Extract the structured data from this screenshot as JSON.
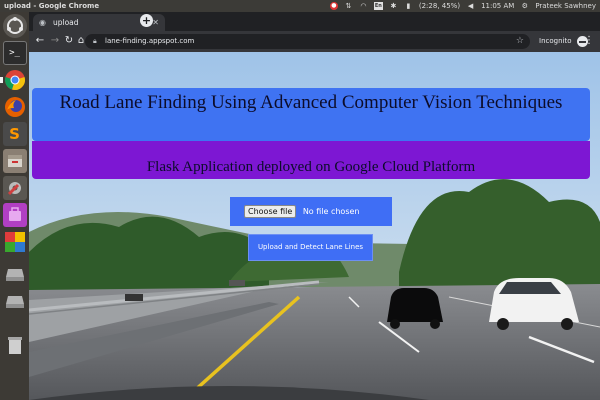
{
  "system_bar": {
    "window_title": "upload - Google Chrome",
    "keyboard": "En",
    "battery": "(2:28, 45%)",
    "time": "11:05 AM",
    "user": "Prateek Sawhney"
  },
  "launcher": {
    "items": [
      {
        "icon": "ubuntu-dash-icon",
        "color": "#c8c8c8"
      },
      {
        "icon": "terminal-icon",
        "color": "#2b2b2b"
      },
      {
        "icon": "chrome-icon",
        "color": "#e8a02a"
      },
      {
        "icon": "firefox-icon",
        "color": "#e66000"
      },
      {
        "icon": "sublime-text-icon",
        "color": "#4a4a4a"
      },
      {
        "icon": "files-icon",
        "color": "#8a7f73"
      },
      {
        "icon": "system-settings-icon",
        "color": "#d04040"
      },
      {
        "icon": "ubuntu-software-icon",
        "color": "#b13fc3"
      },
      {
        "icon": "libreoffice-icon",
        "color": "#39a82e"
      },
      {
        "icon": "drive-icon",
        "color": "#9b9b9b"
      },
      {
        "icon": "drive-icon-2",
        "color": "#9b9b9b"
      },
      {
        "icon": "trash-icon",
        "color": "#a6a6a6"
      }
    ]
  },
  "browser": {
    "tab_title": "upload",
    "url": "lane-finding.appspot.com",
    "incognito_label": "Incognito"
  },
  "page": {
    "heading": "Road Lane Finding Using Advanced Computer Vision Techniques",
    "subheading": "Flask Application deployed on Google Cloud Platform",
    "choose_file_label": "Choose file",
    "no_file_text": "No file chosen",
    "upload_button_label": "Upload and Detect Lane Lines"
  },
  "colors": {
    "heading_bg": "#3f73f2",
    "subheading_bg": "#7d17d3",
    "form_bg": "#3f6ef5"
  }
}
